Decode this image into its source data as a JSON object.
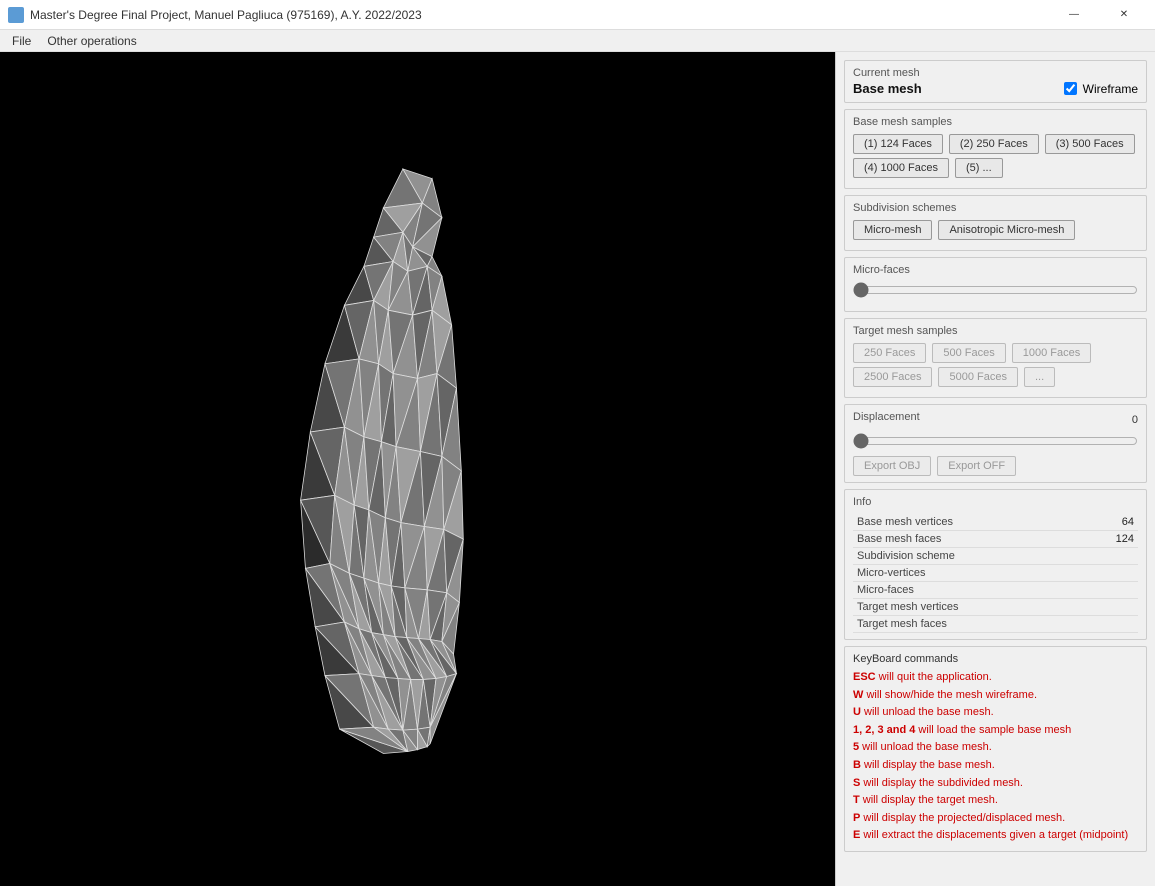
{
  "titleBar": {
    "title": "Master's Degree Final Project, Manuel Pagliuca (975169), A.Y. 2022/2023",
    "icon": "app-icon",
    "controls": {
      "minimize": "—",
      "close": "✕"
    }
  },
  "menuBar": {
    "items": [
      "File",
      "Other operations"
    ]
  },
  "currentMesh": {
    "label": "Current mesh",
    "value": "Base mesh",
    "wireframe_label": "Wireframe",
    "wireframe_checked": true
  },
  "baseMeshSamples": {
    "label": "Base mesh samples",
    "buttons": [
      "(1) 124 Faces",
      "(2) 250 Faces",
      "(3) 500 Faces",
      "(4) 1000 Faces",
      "(5) ..."
    ]
  },
  "subdivisionSchemes": {
    "label": "Subdivision schemes",
    "buttons": [
      "Micro-mesh",
      "Anisotropic Micro-mesh"
    ]
  },
  "microFaces": {
    "label": "Micro-faces",
    "value": 0,
    "min": 0,
    "max": 100
  },
  "targetMeshSamples": {
    "label": "Target mesh samples",
    "buttons": [
      "250 Faces",
      "500 Faces",
      "1000 Faces",
      "2500 Faces",
      "5000 Faces",
      "..."
    ]
  },
  "displacement": {
    "label": "Displacement",
    "value": 0,
    "min": 0,
    "max": 100
  },
  "export": {
    "obj_label": "Export OBJ",
    "off_label": "Export OFF"
  },
  "info": {
    "label": "Info",
    "rows": [
      {
        "key": "Base mesh vertices",
        "value": "64"
      },
      {
        "key": "Base mesh faces",
        "value": "124"
      },
      {
        "key": "Subdivision scheme",
        "value": ""
      },
      {
        "key": "Micro-vertices",
        "value": ""
      },
      {
        "key": "Micro-faces",
        "value": ""
      },
      {
        "key": "Target mesh vertices",
        "value": ""
      },
      {
        "key": "Target mesh faces",
        "value": ""
      }
    ]
  },
  "keyboard": {
    "label": "KeyBoard commands",
    "commands": [
      {
        "key": "ESC",
        "text": " will quit the application."
      },
      {
        "key": "W",
        "text": " will show/hide the mesh wireframe."
      },
      {
        "key": "U",
        "text": " will unload the base mesh."
      },
      {
        "key": "1, 2, 3 and 4",
        "text": " will load the sample base mesh"
      },
      {
        "key": "5",
        "text": " will unload the base mesh."
      },
      {
        "key": "B",
        "text": " will display the base mesh."
      },
      {
        "key": "S",
        "text": " will display the subdivided mesh."
      },
      {
        "key": "T",
        "text": " will display the target mesh."
      },
      {
        "key": "P",
        "text": " will display the projected/displaced mesh."
      },
      {
        "key": "E",
        "text": " will extract the displacements given a target (midpoint)"
      }
    ]
  }
}
